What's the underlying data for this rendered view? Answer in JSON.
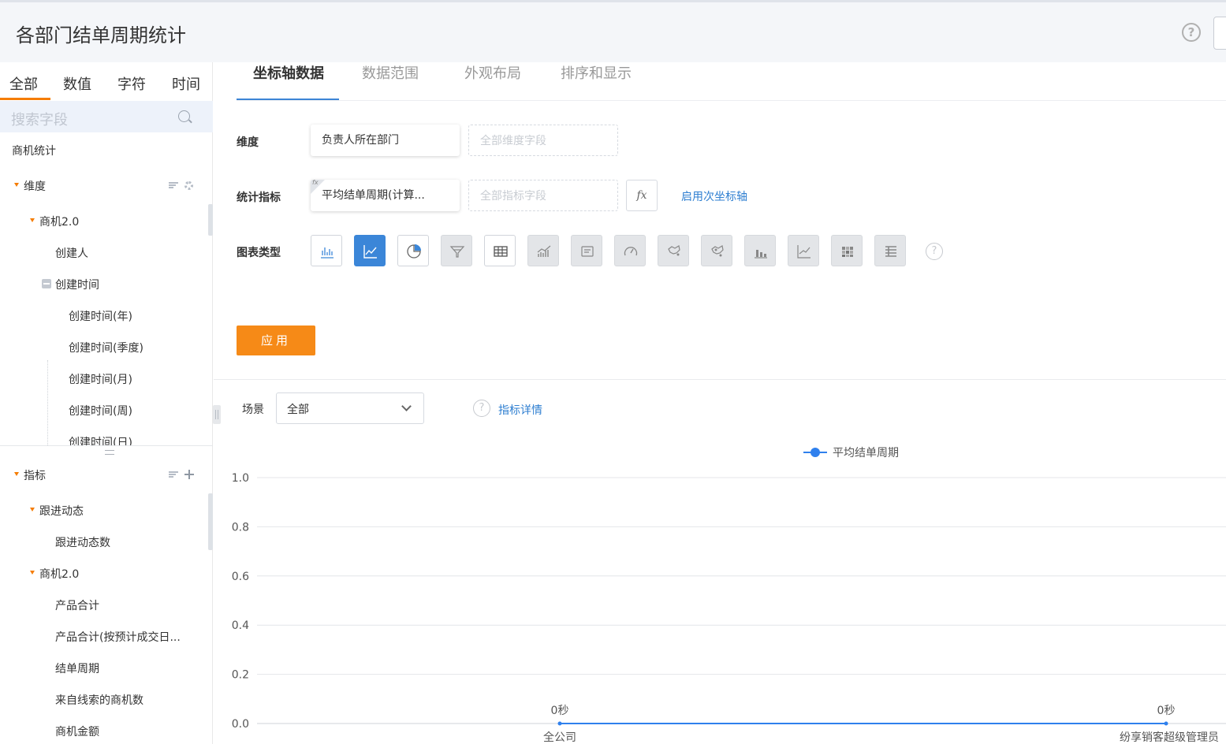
{
  "header": {
    "title": "各部门结单周期统计",
    "help_icon": "question-circle-icon"
  },
  "sidebar": {
    "tabs": [
      "全部",
      "数值",
      "字符",
      "时间"
    ],
    "active_tab": 0,
    "search_placeholder": "搜索字段",
    "source": "商机统计",
    "dimension_group": "维度",
    "dimension_items": [
      {
        "label": "商机2.0",
        "level": 1
      },
      {
        "label": "创建人",
        "level": 2
      },
      {
        "label": "创建时间",
        "level": 2
      },
      {
        "label": "创建时间(年)",
        "level": 3
      },
      {
        "label": "创建时间(季度)",
        "level": 3
      },
      {
        "label": "创建时间(月)",
        "level": 3
      },
      {
        "label": "创建时间(周)",
        "level": 3
      },
      {
        "label": "创建时间(日)",
        "level": 3
      }
    ],
    "metric_group": "指标",
    "metric_items": [
      {
        "label": "跟进动态",
        "level": 1
      },
      {
        "label": "跟进动态数",
        "level": 2
      },
      {
        "label": "商机2.0",
        "level": 1
      },
      {
        "label": "产品合计",
        "level": 2
      },
      {
        "label": "产品合计(按预计成交日...",
        "level": 2
      },
      {
        "label": "结单周期",
        "level": 2
      },
      {
        "label": "来自线索的商机数",
        "level": 2
      },
      {
        "label": "商机金额",
        "level": 2
      }
    ]
  },
  "main": {
    "tabs": [
      "坐标轴数据",
      "数据范围",
      "外观布局",
      "排序和显示"
    ],
    "active_tab": 0,
    "dimension_label": "维度",
    "dimension_value": "负责人所在部门",
    "dimension_placeholder": "全部维度字段",
    "metric_label": "统计指标",
    "metric_value": "平均结单周期(计算...",
    "metric_fx_tag": "fx",
    "metric_placeholder": "全部指标字段",
    "fx_button": "fx",
    "secondary_axis_link": "启用次坐标轴",
    "chart_type_label": "图表类型",
    "chart_types": [
      "bar",
      "line",
      "pie",
      "funnel",
      "table",
      "combo",
      "card",
      "gauge",
      "map",
      "map-2",
      "stacked-bar",
      "area",
      "heatmap",
      "pivot"
    ],
    "active_chart_type": "line",
    "apply_button": "应用",
    "scene_label": "场景",
    "scene_value": "全部",
    "metric_detail_link": "指标详情",
    "accent_color": "#f68a17",
    "primary_color": "#3b86d8"
  },
  "chart_data": {
    "type": "line",
    "series": [
      {
        "name": "平均结单周期",
        "values": [
          0,
          0
        ],
        "labels": [
          "0秒",
          "0秒"
        ]
      }
    ],
    "categories": [
      "全公司",
      "纷享销客超级管理员"
    ],
    "y_ticks": [
      "0.0",
      "0.2",
      "0.4",
      "0.6",
      "0.8",
      "1.0"
    ],
    "ylim": [
      0,
      1
    ],
    "grid": true,
    "legend_position": "top-center",
    "color": "#2f80ed"
  }
}
